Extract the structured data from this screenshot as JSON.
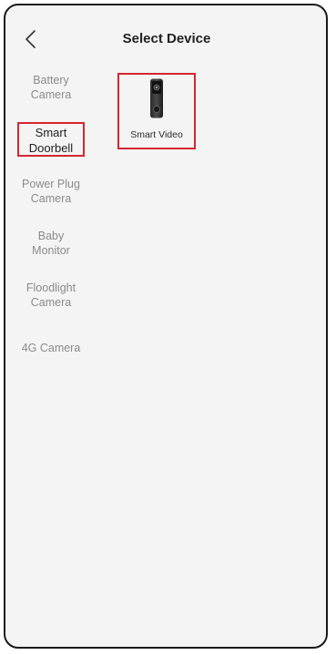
{
  "header": {
    "back_icon": "chevron-left-icon",
    "title": "Select Device"
  },
  "categories": [
    {
      "label_line1": "Battery",
      "label_line2": "Camera",
      "selected": false
    },
    {
      "label_line1": "Smart",
      "label_line2": "Doorbell",
      "selected": true
    },
    {
      "label_line1": "Power Plug",
      "label_line2": "Camera",
      "selected": false
    },
    {
      "label_line1": "Baby",
      "label_line2": "Monitor",
      "selected": false
    },
    {
      "label_line1": "Floodlight",
      "label_line2": "Camera",
      "selected": false
    },
    {
      "label_line1": "4G Camera",
      "label_line2": "",
      "selected": false
    }
  ],
  "devices": [
    {
      "name": "Smart Video",
      "icon": "video-doorbell-icon"
    }
  ],
  "colors": {
    "highlight": "#d4262e",
    "background": "#f4f4f4",
    "inactive_text": "#8b8b8b",
    "active_text": "#1e1e1e"
  }
}
